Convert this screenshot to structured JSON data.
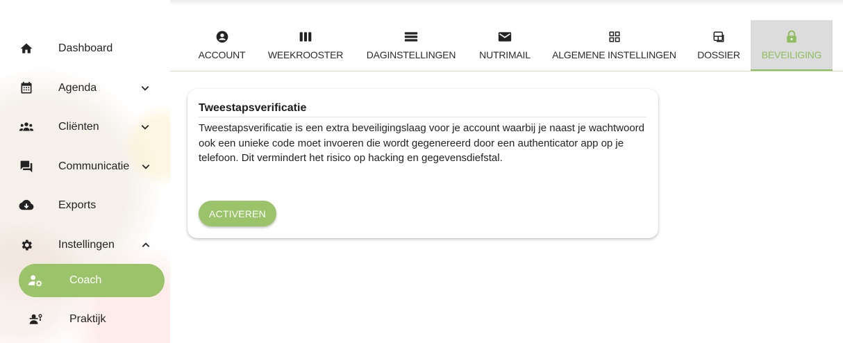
{
  "sidebar": {
    "items": [
      {
        "label": "Dashboard",
        "icon": "home-icon"
      },
      {
        "label": "Agenda",
        "icon": "calendar-icon"
      },
      {
        "label": "Cliënten",
        "icon": "clients-icon"
      },
      {
        "label": "Communicatie",
        "icon": "chat-icon"
      },
      {
        "label": "Exports",
        "icon": "cloud-download-icon"
      },
      {
        "label": "Instellingen",
        "icon": "gear-icon"
      }
    ],
    "sub_items": [
      {
        "label": "Coach",
        "icon": "user-settings-icon",
        "active": true
      },
      {
        "label": "Praktijk",
        "icon": "practice-icon",
        "active": false
      }
    ]
  },
  "tabs": [
    {
      "label": "ACCOUNT",
      "icon": "account-circle-icon"
    },
    {
      "label": "WEEKROOSTER",
      "icon": "columns-icon"
    },
    {
      "label": "DAGINSTELLINGEN",
      "icon": "rows-icon"
    },
    {
      "label": "NUTRIMAIL",
      "icon": "mail-icon"
    },
    {
      "label": "ALGEMENE INSTELLINGEN",
      "icon": "grid-icon"
    },
    {
      "label": "DOSSIER",
      "icon": "dossier-icon"
    },
    {
      "label": "BEVEILIGING",
      "icon": "lock-icon",
      "active": true
    }
  ],
  "card": {
    "title": "Tweestapsverificatie",
    "body": "Tweestapsverificatie is een extra beveiligingslaag voor je account waarbij je naast je wachtwoord ook een unieke code moet invoeren die wordt gegenereerd door een authenticator app op je telefoon. Dit vermindert het risico op hacking en gegevensdiefstal.",
    "button_label": "ACTIVEREN"
  },
  "colors": {
    "accent": "#9bc46a",
    "accent_text": "#8fbd5f",
    "active_tab_bg": "#dcdcdc"
  }
}
